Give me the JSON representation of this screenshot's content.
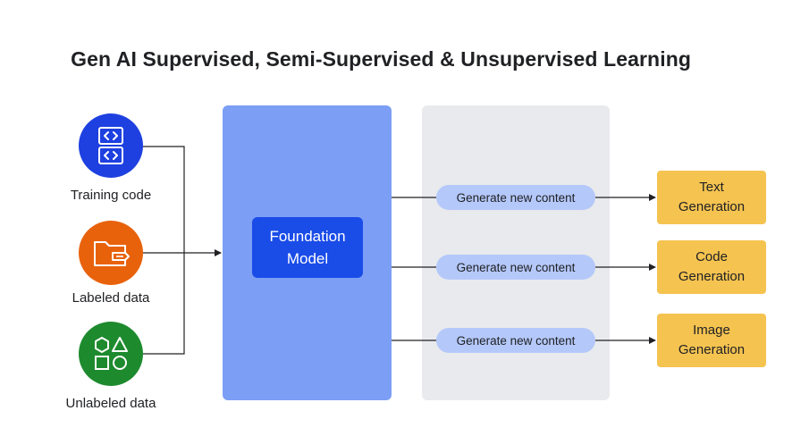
{
  "title": "Gen AI Supervised, Semi-Supervised & Unsupervised Learning",
  "sources": [
    {
      "label": "Training code",
      "icon": "code-icon",
      "color": "#1e40e0"
    },
    {
      "label": "Labeled data",
      "icon": "folder-icon",
      "color": "#e8620c"
    },
    {
      "label": "Unlabeled data",
      "icon": "shapes-icon",
      "color": "#1e8a2e"
    }
  ],
  "model": {
    "label": "Foundation\nModel",
    "color": "#1a4ce8",
    "panel_color": "#7c9ff5"
  },
  "steps": [
    {
      "label": "Generate new content"
    },
    {
      "label": "Generate new content"
    },
    {
      "label": "Generate new content"
    }
  ],
  "outputs": [
    {
      "label": "Text\nGeneration"
    },
    {
      "label": "Code\nGeneration"
    },
    {
      "label": "Image\nGeneration"
    }
  ],
  "colors": {
    "pill": "#b4c8fa",
    "output": "#f5c350",
    "gen_panel": "#e8eaed"
  }
}
